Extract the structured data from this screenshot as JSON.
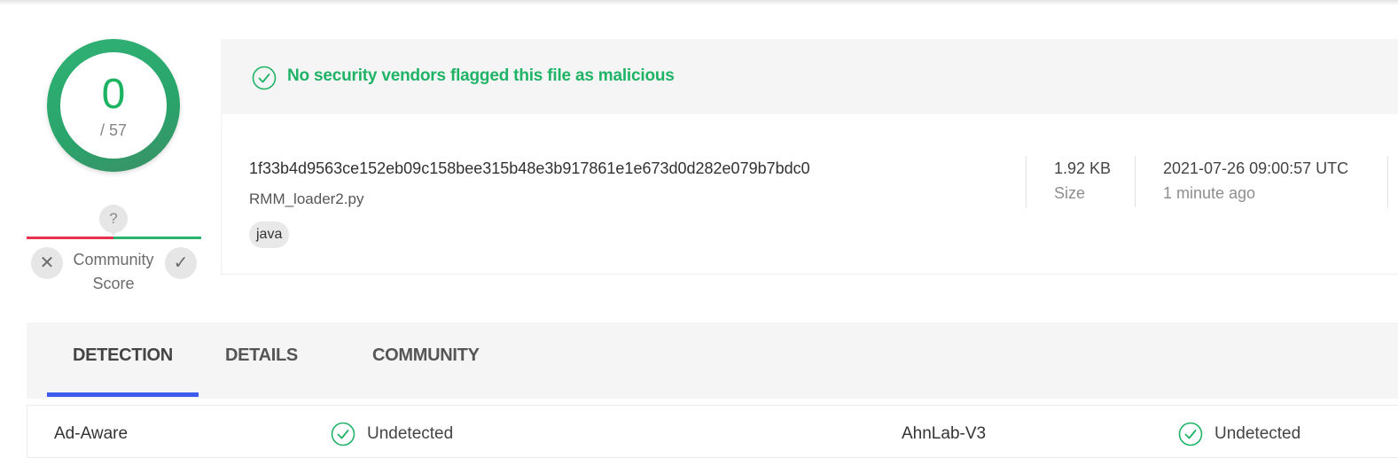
{
  "score": {
    "detections": "0",
    "total": "/ 57"
  },
  "community": {
    "unknown_icon": "?",
    "down_icon": "✕",
    "up_icon": "✓",
    "label_line1": "Community",
    "label_line2": "Score"
  },
  "banner": {
    "message": "No security vendors flagged this file as malicious"
  },
  "file": {
    "hash": "1f33b4d9563ce152eb09c158bee315b48e3b917861e1e673d0d282e079b7bdc0",
    "name": "RMM_loader2.py",
    "tag": "java",
    "size_value": "1.92 KB",
    "size_label": "Size",
    "date_value": "2021-07-26 09:00:57 UTC",
    "date_relative": "1 minute ago"
  },
  "tabs": [
    {
      "label": "DETECTION",
      "active": true
    },
    {
      "label": "DETAILS",
      "active": false
    },
    {
      "label": "COMMUNITY",
      "active": false
    }
  ],
  "detections": [
    {
      "engine": "Ad-Aware",
      "result": "Undetected"
    },
    {
      "engine": "AhnLab-V3",
      "result": "Undetected"
    }
  ],
  "colors": {
    "clean_green": "#1fb366",
    "malicious_red": "#e6324f",
    "tab_accent": "#3b5bec"
  }
}
